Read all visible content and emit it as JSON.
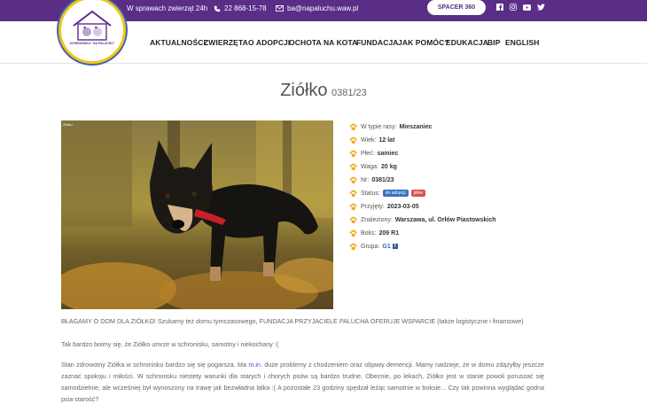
{
  "topbar": {
    "hours": "W sprawach zwierząt 24h",
    "phone": "22 868-15-78",
    "email": "ba@napaluchu.waw.pl",
    "spacer_button": "SPACER 360",
    "social_icons": [
      "facebook-icon",
      "instagram-icon",
      "youtube-icon",
      "twitter-icon"
    ],
    "color": "#5a2d86"
  },
  "logo": {
    "text": "SCHRONISKO \"NA PALUCHU\""
  },
  "nav": {
    "items": [
      "AKTUALNOŚCI",
      "ZWIERZĘTA",
      "O ADOPCJI",
      "OCHOTA NA KOTA",
      "FUNDACJA",
      "JAK POMÓC?",
      "EDUKACJA",
      "BIP",
      "ENGLISH"
    ]
  },
  "animal": {
    "name": "Ziółko",
    "number": "0381/23",
    "photo_caption": "Ziółko"
  },
  "details": {
    "breed_label": "W typie rasy:",
    "breed": "Mieszaniec",
    "age_label": "Wiek:",
    "age": "12 lat",
    "sex_label": "Płeć:",
    "sex": "samiec",
    "weight_label": "Waga:",
    "weight": "20 kg",
    "nr_label": "Nr:",
    "nr": "0381/23",
    "status_label": "Status:",
    "status_badge_1": "do adopcji",
    "status_badge_2": "pilne",
    "admitted_label": "Przyjęty:",
    "admitted": "2023-03-05",
    "found_label": "Znaleziony:",
    "found": "Warszawa, ul. Orłów Piastowskich",
    "box_label": "Boks:",
    "box": "209 R1",
    "group_label": "Grupa:",
    "group": "G1"
  },
  "body": {
    "p1": "BŁAGAMY O DOM DLA ZIÓŁKO! Szukamy też domu tymczasowego, FUNDACJA PRZYJACIELE PALUCHA OFERUJE WSPARCIE (także logistyczne i finansowe)",
    "p2": "Tak bardzo boimy się, że Ziółko umrze w schronisku, samotny i niekochany :(",
    "p3_a": "Stan zdrowotny Ziółka w schronisku bardzo się się pogarsza. Ma ",
    "p3_link": "m.in.",
    "p3_b": " duże problemy z chodzeniem oraz objawy demencji. Mamy nadzieje, że w domu zdążyłby jeszcze zaznać spokoju i miłości. W schronisku niestety warunki dla starych i chorych psów są bardzo trudne. Obecnie, po lekach, Ziółko jest w stanie powoli poruszać się samodzielnie, ale wcześniej był wynoszony na trawę jak bezwładna lalka :( A pozostałe 23 godziny spędzał leżąc samotnie w boksie... Czy tak powinna wyglądać godna psia starość?"
  }
}
